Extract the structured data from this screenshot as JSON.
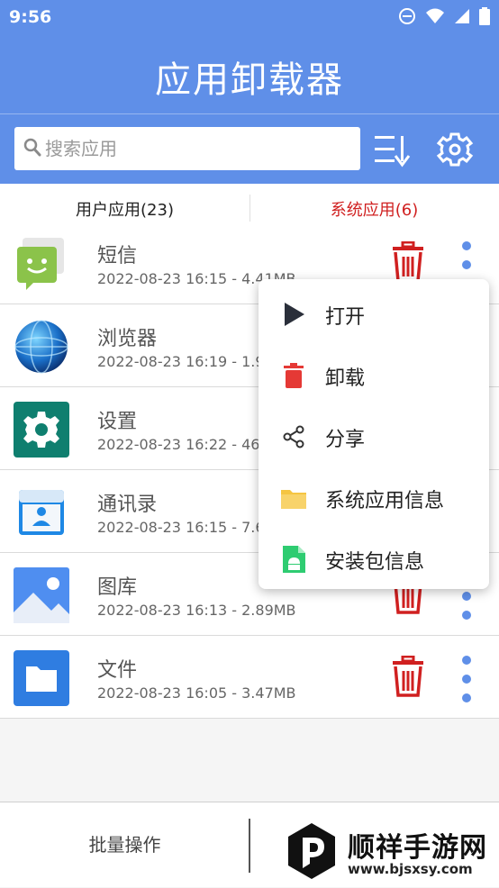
{
  "status_bar": {
    "time": "9:56"
  },
  "app_bar": {
    "title": "应用卸载器"
  },
  "search": {
    "placeholder": "搜索应用",
    "value": ""
  },
  "tabs": [
    {
      "label": "用户应用(23)",
      "active": false
    },
    {
      "label": "系统应用(6)",
      "active": true,
      "color": "#d02020"
    }
  ],
  "apps": [
    {
      "name": "短信",
      "meta": "2022-08-23 16:15 - 4.41MB",
      "icon": "messaging-icon"
    },
    {
      "name": "浏览器",
      "meta": "2022-08-23 16:19 - 1.9",
      "icon": "browser-globe-icon"
    },
    {
      "name": "设置",
      "meta": "2022-08-23 16:22 - 46",
      "icon": "settings-gear-icon"
    },
    {
      "name": "通讯录",
      "meta": "2022-08-23 16:15 - 7.6",
      "icon": "contacts-icon"
    },
    {
      "name": "图库",
      "meta": "2022-08-23 16:13 - 2.89MB",
      "icon": "gallery-icon"
    },
    {
      "name": "文件",
      "meta": "2022-08-23 16:05 - 3.47MB",
      "icon": "files-folder-icon"
    }
  ],
  "context_menu": {
    "items": [
      {
        "label": "打开",
        "icon": "play-icon"
      },
      {
        "label": "卸载",
        "icon": "trash-icon"
      },
      {
        "label": "分享",
        "icon": "share-icon"
      },
      {
        "label": "系统应用信息",
        "icon": "folder-icon"
      },
      {
        "label": "安装包信息",
        "icon": "apk-file-icon"
      }
    ]
  },
  "bottom_bar": {
    "batch_label": "批量操作"
  },
  "watermark": {
    "brand": "顺祥手游网",
    "url": "www.bjsxsy.com"
  },
  "colors": {
    "primary": "#5f8fe8",
    "danger": "#d02020",
    "dot": "#5f8fe8"
  }
}
